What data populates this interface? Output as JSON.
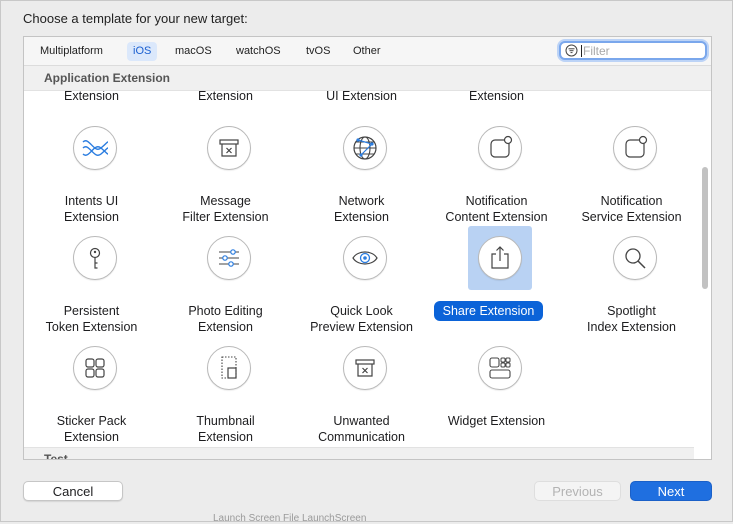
{
  "dialog": {
    "heading": "Choose a template for your new target:"
  },
  "tabs": [
    {
      "label": "Multiplatform",
      "selected": false
    },
    {
      "label": "iOS",
      "selected": true
    },
    {
      "label": "macOS",
      "selected": false
    },
    {
      "label": "watchOS",
      "selected": false
    },
    {
      "label": "tvOS",
      "selected": false
    },
    {
      "label": "Other",
      "selected": false
    }
  ],
  "filter": {
    "placeholder": "Filter",
    "value": ""
  },
  "section": {
    "title": "Application Extension",
    "next_title": "Test"
  },
  "partial_row": [
    "Extension",
    "Extension",
    "UI Extension",
    "Extension"
  ],
  "templates": [
    {
      "line1": "Intents UI",
      "line2": "Extension",
      "icon": "intents-ui-icon"
    },
    {
      "line1": "Message",
      "line2": "Filter Extension",
      "icon": "message-filter-icon"
    },
    {
      "line1": "Network",
      "line2": "Extension",
      "icon": "network-globe-icon"
    },
    {
      "line1": "Notification",
      "line2": "Content Extension",
      "icon": "notification-content-icon"
    },
    {
      "line1": "Notification",
      "line2": "Service Extension",
      "icon": "notification-service-icon"
    },
    {
      "line1": "Persistent",
      "line2": "Token Extension",
      "icon": "key-icon"
    },
    {
      "line1": "Photo Editing",
      "line2": "Extension",
      "icon": "sliders-icon"
    },
    {
      "line1": "Quick Look",
      "line2": "Preview Extension",
      "icon": "eye-icon"
    },
    {
      "line1": "Share Extension",
      "line2": "",
      "icon": "share-icon",
      "selected": true
    },
    {
      "line1": "Spotlight",
      "line2": "Index Extension",
      "icon": "magnifier-icon"
    },
    {
      "line1": "Sticker Pack",
      "line2": "Extension",
      "icon": "sticker-grid-icon"
    },
    {
      "line1": "Thumbnail",
      "line2": "Extension",
      "icon": "thumbnail-icon"
    },
    {
      "line1": "Unwanted",
      "line2": "Communication",
      "icon": "unwanted-tray-icon"
    },
    {
      "line1": "Widget Extension",
      "line2": "",
      "icon": "widget-icon"
    }
  ],
  "buttons": {
    "cancel": "Cancel",
    "previous": "Previous",
    "next": "Next"
  },
  "background_text": "Launch Screen File   LaunchScreen",
  "colors": {
    "accent": "#1f6fe0",
    "selection_bg": "#b9d2f3",
    "selected_label": "#0b63d8"
  }
}
